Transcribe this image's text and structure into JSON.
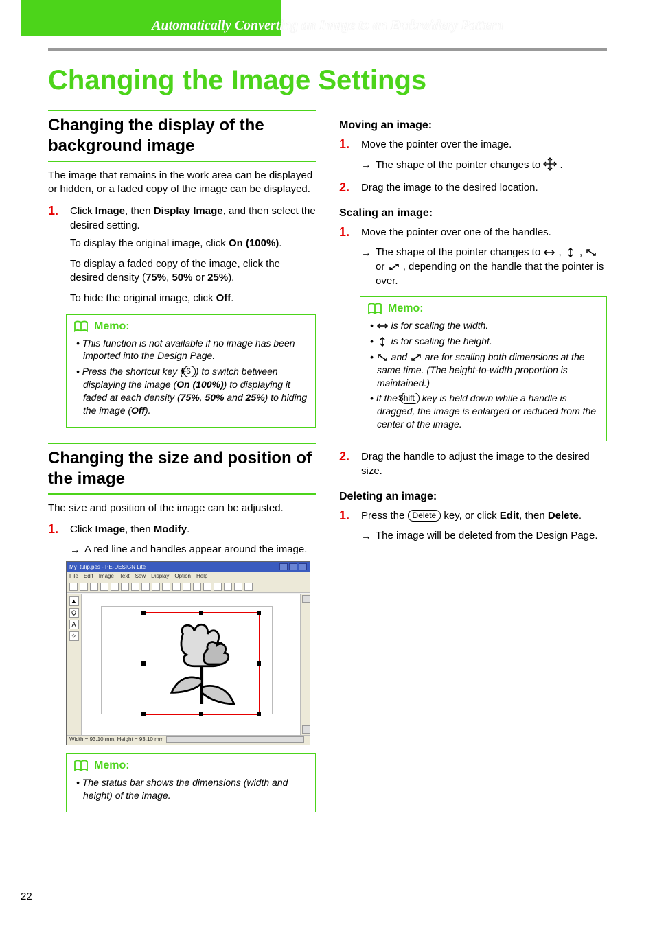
{
  "header": {
    "banner": "Automatically Converting an Image to an Embroidery Pattern"
  },
  "title": "Changing the Image Settings",
  "left": {
    "section1": {
      "heading": "Changing the display of the background image",
      "intro": "The image that remains in the work area can be displayed or hidden, or a faded copy of the image can be displayed.",
      "step1_a": "Click ",
      "step1_b": "Image",
      "step1_c": ", then ",
      "step1_d": "Display Image",
      "step1_e": ", and then select the desired setting.",
      "p2_a": "To display the original image, click ",
      "p2_b": "On (100%)",
      "p2_c": ".",
      "p3_a": "To display a faded copy of the image, click the desired density (",
      "p3_b": "75%",
      "p3_c": ", ",
      "p3_d": "50%",
      "p3_e": " or ",
      "p3_f": "25%",
      "p3_g": ").",
      "p4_a": "To hide the original image, click ",
      "p4_b": "Off",
      "p4_c": ".",
      "memo1": {
        "title": "Memo:",
        "li1": "This function is not available if no image has been imported into the Design Page.",
        "li2_a": "Press the shortcut key (",
        "li2_key": "F6",
        "li2_b": ") to switch between displaying the image (",
        "li2_c": "On (100%)",
        "li2_d": ") to displaying it faded at each density (",
        "li2_e": "75%",
        "li2_f": ", ",
        "li2_g": "50%",
        "li2_h": " and ",
        "li2_i": "25%",
        "li2_j": ") to hiding the image (",
        "li2_k": "Off",
        "li2_l": ")."
      }
    },
    "section2": {
      "heading": "Changing the size and position of the image",
      "intro": "The size and position of the image can be adjusted.",
      "step1_a": "Click ",
      "step1_b": "Image",
      "step1_c": ", then ",
      "step1_d": "Modify",
      "step1_e": ".",
      "result": "A red line and handles appear around the image.",
      "screenshot": {
        "title": "My_tulip.pes - PE-DESIGN Lite",
        "menus": [
          "File",
          "Edit",
          "Image",
          "Text",
          "Sew",
          "Display",
          "Option",
          "Help"
        ],
        "status": "Width = 93.10 mm, Height = 93.10 mm"
      },
      "memo2": {
        "title": "Memo:",
        "li1": "The status bar shows the dimensions (width and height) of the image."
      }
    }
  },
  "right": {
    "moving": {
      "heading": "Moving an image:",
      "step1": "Move the pointer over the image.",
      "result_a": "The shape of the pointer changes to ",
      "result_b": " .",
      "step2": "Drag the image to the desired location."
    },
    "scaling": {
      "heading": "Scaling an image:",
      "step1": "Move the pointer over one of the handles.",
      "result_a": "The shape of the pointer changes to ",
      "result_b": " , ",
      "result_c": " , ",
      "result_d": " or ",
      "result_e": " , depending on the handle that the pointer is over.",
      "memo": {
        "title": "Memo:",
        "li1_b": " is for scaling the width.",
        "li2_b": " is for scaling the height.",
        "li3_b": " and ",
        "li3_c": " are for scaling both dimensions at the same time. (The height-to-width proportion is maintained.)",
        "li4_a": "If the ",
        "li4_key": "Shift",
        "li4_b": " key is held down while a handle is dragged, the image is enlarged or reduced from the center of the image."
      },
      "step2": "Drag the handle to adjust the image to the desired size."
    },
    "deleting": {
      "heading": "Deleting an image:",
      "step1_a": "Press the ",
      "step1_key": "Delete",
      "step1_b": " key, or click ",
      "step1_c": "Edit",
      "step1_d": ", then ",
      "step1_e": "Delete",
      "step1_f": ".",
      "result": "The image will be deleted from the Design Page."
    }
  },
  "page_number": "22"
}
